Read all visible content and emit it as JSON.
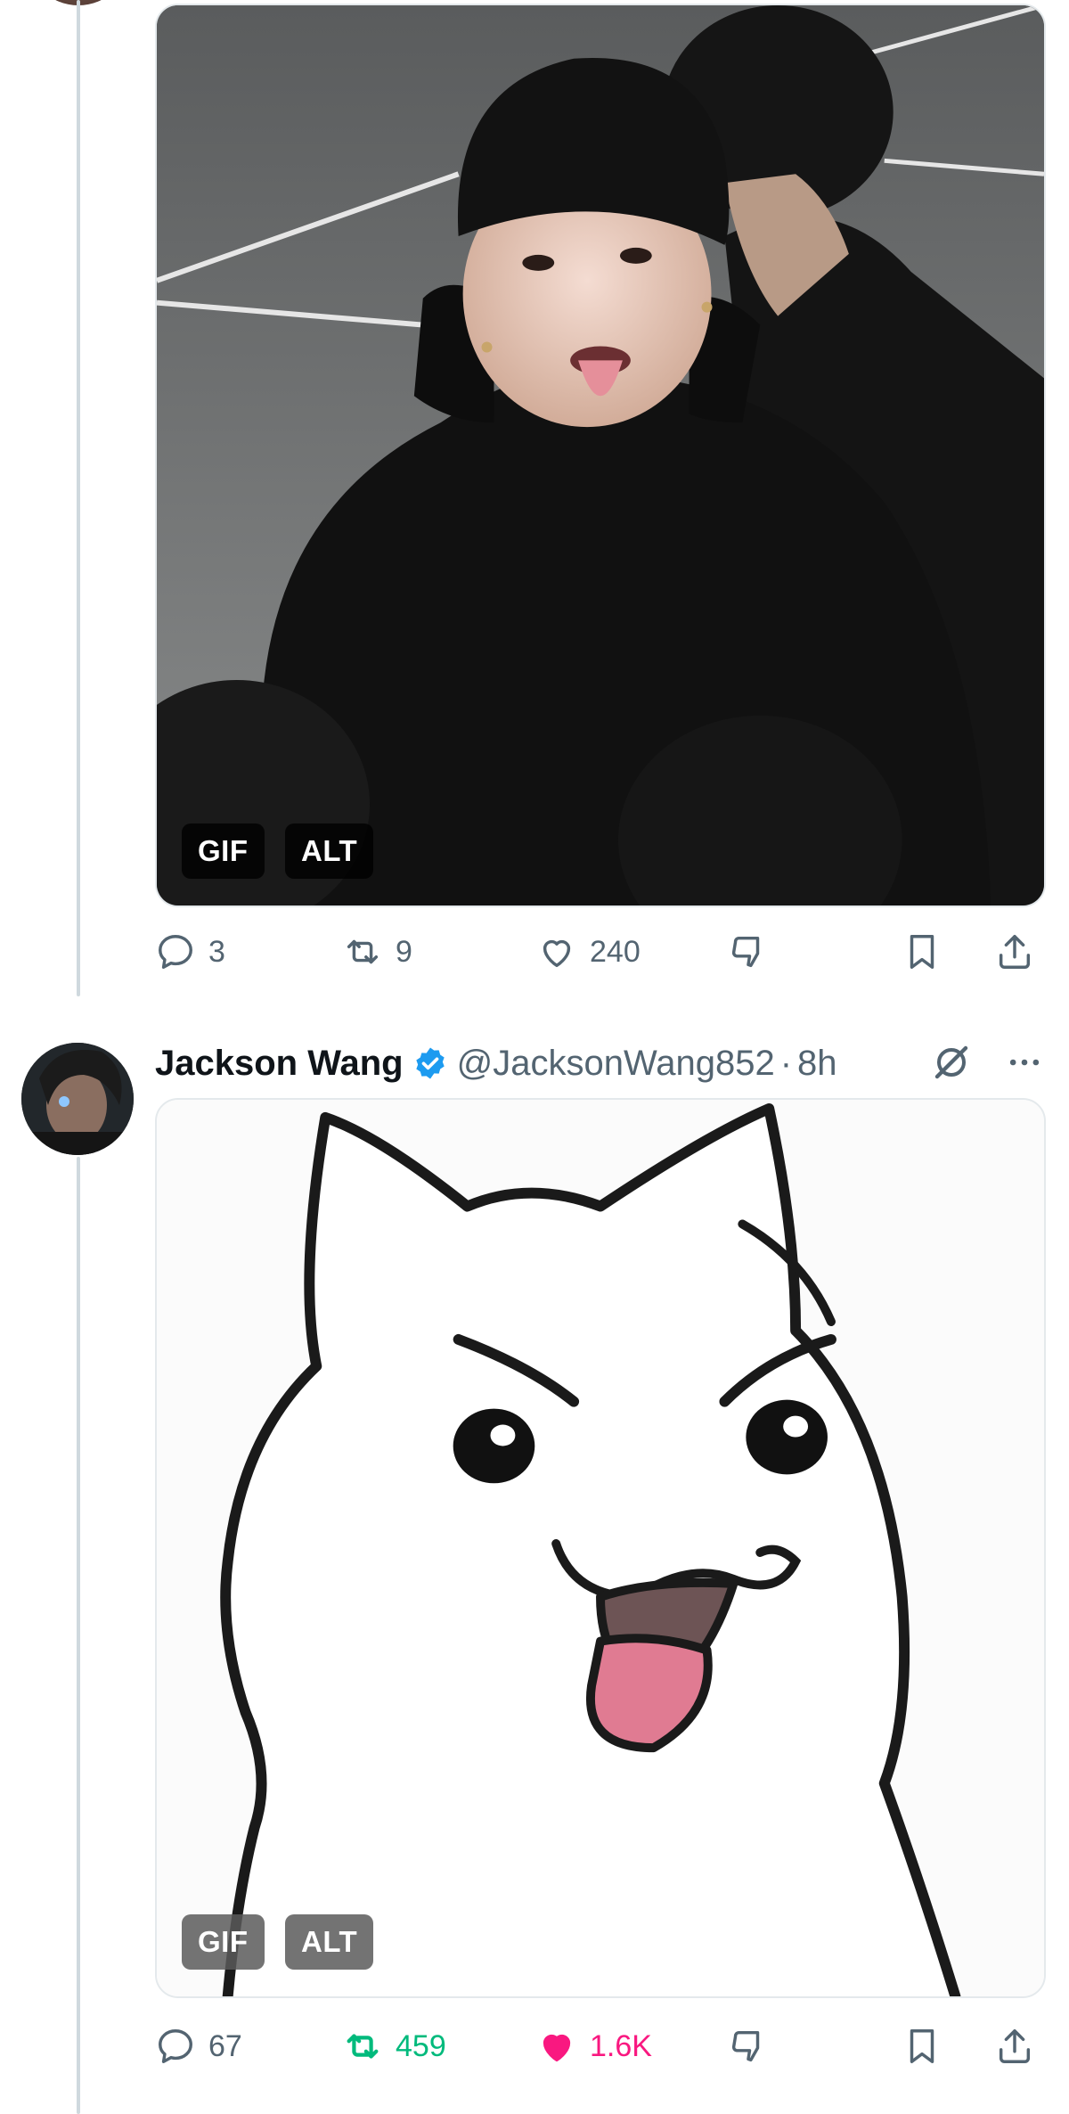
{
  "tweet1": {
    "media_badges": {
      "gif": "GIF",
      "alt": "ALT"
    },
    "actions": {
      "replies": "3",
      "retweets": "9",
      "likes": "240"
    }
  },
  "tweet2": {
    "author_name": "Jackson Wang",
    "handle": "@JacksonWang852",
    "separator": "·",
    "time": "8h",
    "verified": true,
    "media_badges": {
      "gif": "GIF",
      "alt": "ALT"
    },
    "actions": {
      "replies": "67",
      "retweets": "459",
      "likes": "1.6K"
    },
    "retweeted": true,
    "liked": true
  },
  "colors": {
    "retweet_green": "#00ba7c",
    "like_pink": "#f91880",
    "verified_blue": "#1d9bf0",
    "muted_gray": "#536471",
    "thread_line": "#cfd9de"
  },
  "icons": [
    "reply-icon",
    "retweet-icon",
    "like-icon",
    "downvote-icon",
    "bookmark-icon",
    "share-icon",
    "verified-badge-icon",
    "grok-icon",
    "more-icon"
  ]
}
